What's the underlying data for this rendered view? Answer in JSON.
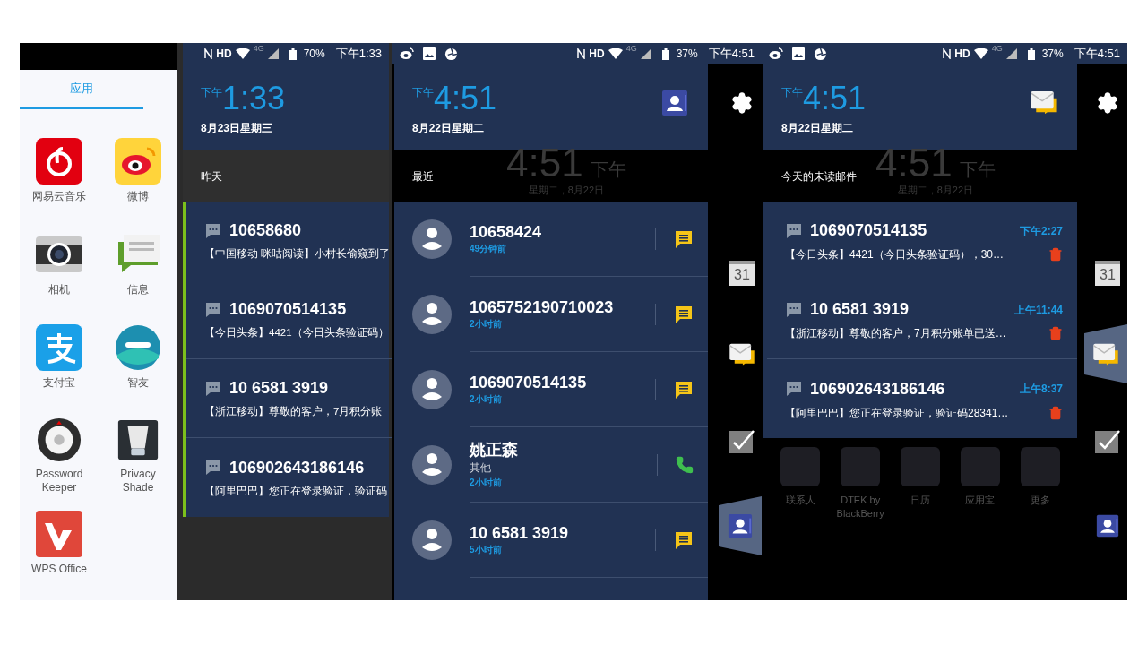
{
  "app_drawer": {
    "tab": {
      "label": "应用",
      "selected": true
    },
    "apps": [
      {
        "kind": "music",
        "label": "网易云音乐"
      },
      {
        "kind": "weibo",
        "label": "微博"
      },
      {
        "kind": "camera",
        "label": "相机"
      },
      {
        "kind": "messages",
        "label": "信息"
      },
      {
        "kind": "alipay",
        "label": "支付宝"
      },
      {
        "kind": "zhiyou",
        "label": "智友"
      },
      {
        "kind": "password",
        "label": "Password Keeper"
      },
      {
        "kind": "privacy",
        "label": "Privacy Shade"
      },
      {
        "kind": "wps",
        "label": "WPS Office"
      }
    ]
  },
  "screens": [
    {
      "kind": "messages",
      "status": {
        "app_icons": false,
        "network": "HD",
        "signal": "4G",
        "battery": "70%",
        "time": "下午1:33"
      },
      "clock": {
        "ampm": "下午",
        "time": "1:33",
        "date": "8月23日星期三"
      },
      "section": "昨天",
      "messages": [
        {
          "sender": "10658680",
          "preview": "【中国移动 咪咕阅读】小村长偷窥到了",
          "unread": true
        },
        {
          "sender": "1069070514135",
          "preview": "【今日头条】4421（今日头条验证码）",
          "unread": true
        },
        {
          "sender": "10 6581 3919",
          "preview": "【浙江移动】尊敬的客户，7月积分账",
          "unread": true
        },
        {
          "sender": "106902643186146",
          "preview": "【阿里巴巴】您正在登录验证，验证码",
          "unread": true
        }
      ]
    },
    {
      "kind": "contacts",
      "status": {
        "app_icons": true,
        "network": "HD",
        "signal": "4G",
        "battery": "37%",
        "time": "下午4:51"
      },
      "clock": {
        "ampm": "下午",
        "time": "4:51",
        "date": "8月22日星期二"
      },
      "header_badge": {
        "kind": "contact"
      },
      "backdrop": {
        "time": "4:51",
        "ampm": "下午",
        "date": "星期二，8月22日"
      },
      "section": "最近",
      "contacts": [
        {
          "name": "10658424",
          "ago": "49分钟前",
          "kind": "message"
        },
        {
          "name": "1065752190710023",
          "ago": "2小时前",
          "kind": "message"
        },
        {
          "name": "1069070514135",
          "ago": "2小时前",
          "kind": "message"
        },
        {
          "name": "姚正森",
          "label": "其他",
          "ago": "2小时前",
          "kind": "call"
        },
        {
          "name": "10 6581 3919",
          "ago": "5小时前",
          "kind": "message"
        }
      ],
      "side": [
        {
          "kind": "settings",
          "selected": false
        },
        {
          "kind": "calendar",
          "day": "31",
          "selected": false
        },
        {
          "kind": "mail",
          "selected": false
        },
        {
          "kind": "tasks",
          "selected": false
        },
        {
          "kind": "contacts",
          "selected": true
        }
      ]
    },
    {
      "kind": "mail",
      "status": {
        "app_icons": true,
        "network": "HD",
        "signal": "4G",
        "battery": "37%",
        "time": "下午4:51"
      },
      "clock": {
        "ampm": "下午",
        "time": "4:51",
        "date": "8月22日星期二"
      },
      "header_badge": {
        "kind": "mail"
      },
      "backdrop": {
        "time": "4:51",
        "ampm": "下午",
        "date": "星期二，8月22日"
      },
      "section": "今天的未读邮件",
      "messages": [
        {
          "sender": "1069070514135",
          "preview": "【今日头条】4421（今日头条验证码），30…",
          "time": "下午2:27"
        },
        {
          "sender": "10 6581 3919",
          "preview": "【浙江移动】尊敬的客户，7月积分账单已送…",
          "time": "上午11:44"
        },
        {
          "sender": "106902643186146",
          "preview": "【阿里巴巴】您正在登录验证，验证码28341…",
          "time": "上午8:37"
        }
      ],
      "dock_labels": [
        "联系人",
        "DTEK by BlackBerry",
        "日历",
        "应用宝",
        "更多"
      ],
      "side": [
        {
          "kind": "settings",
          "selected": false
        },
        {
          "kind": "calendar",
          "day": "31",
          "selected": false
        },
        {
          "kind": "mail",
          "selected": true
        },
        {
          "kind": "tasks",
          "selected": false
        },
        {
          "kind": "contacts",
          "selected": false
        }
      ]
    }
  ]
}
